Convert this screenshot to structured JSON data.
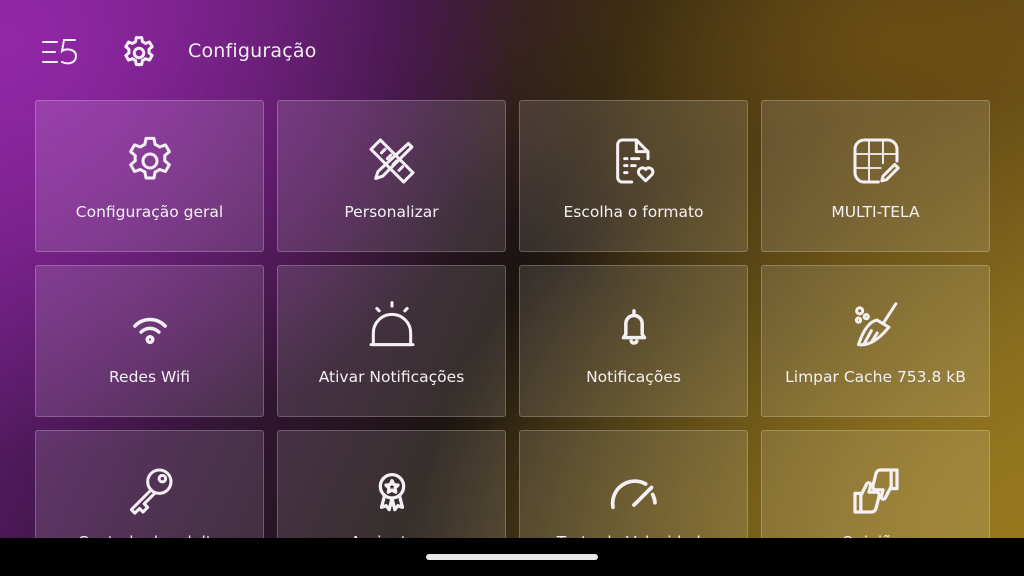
{
  "header": {
    "title": "Configuração"
  },
  "tiles": [
    {
      "label": "Configuração geral",
      "icon": "gear-icon"
    },
    {
      "label": "Personalizar",
      "icon": "ruler-pencil-icon"
    },
    {
      "label": "Escolha o formato",
      "icon": "document-heart-icon"
    },
    {
      "label": "MULTI-TELA",
      "icon": "grid-edit-icon"
    },
    {
      "label": "Redes Wifi",
      "icon": "wifi-icon"
    },
    {
      "label": "Ativar Notificações",
      "icon": "siren-icon"
    },
    {
      "label": "Notificações",
      "icon": "bell-icon"
    },
    {
      "label": "Limpar Cache 753.8 kB",
      "icon": "broom-icon"
    },
    {
      "label": "Controle de adulto",
      "icon": "key-icon"
    },
    {
      "label": "Assinatura",
      "icon": "award-badge-icon"
    },
    {
      "label": "Teste de Velocidade",
      "icon": "speedometer-icon"
    },
    {
      "label": "Opiniões",
      "icon": "thumbs-icon"
    }
  ]
}
